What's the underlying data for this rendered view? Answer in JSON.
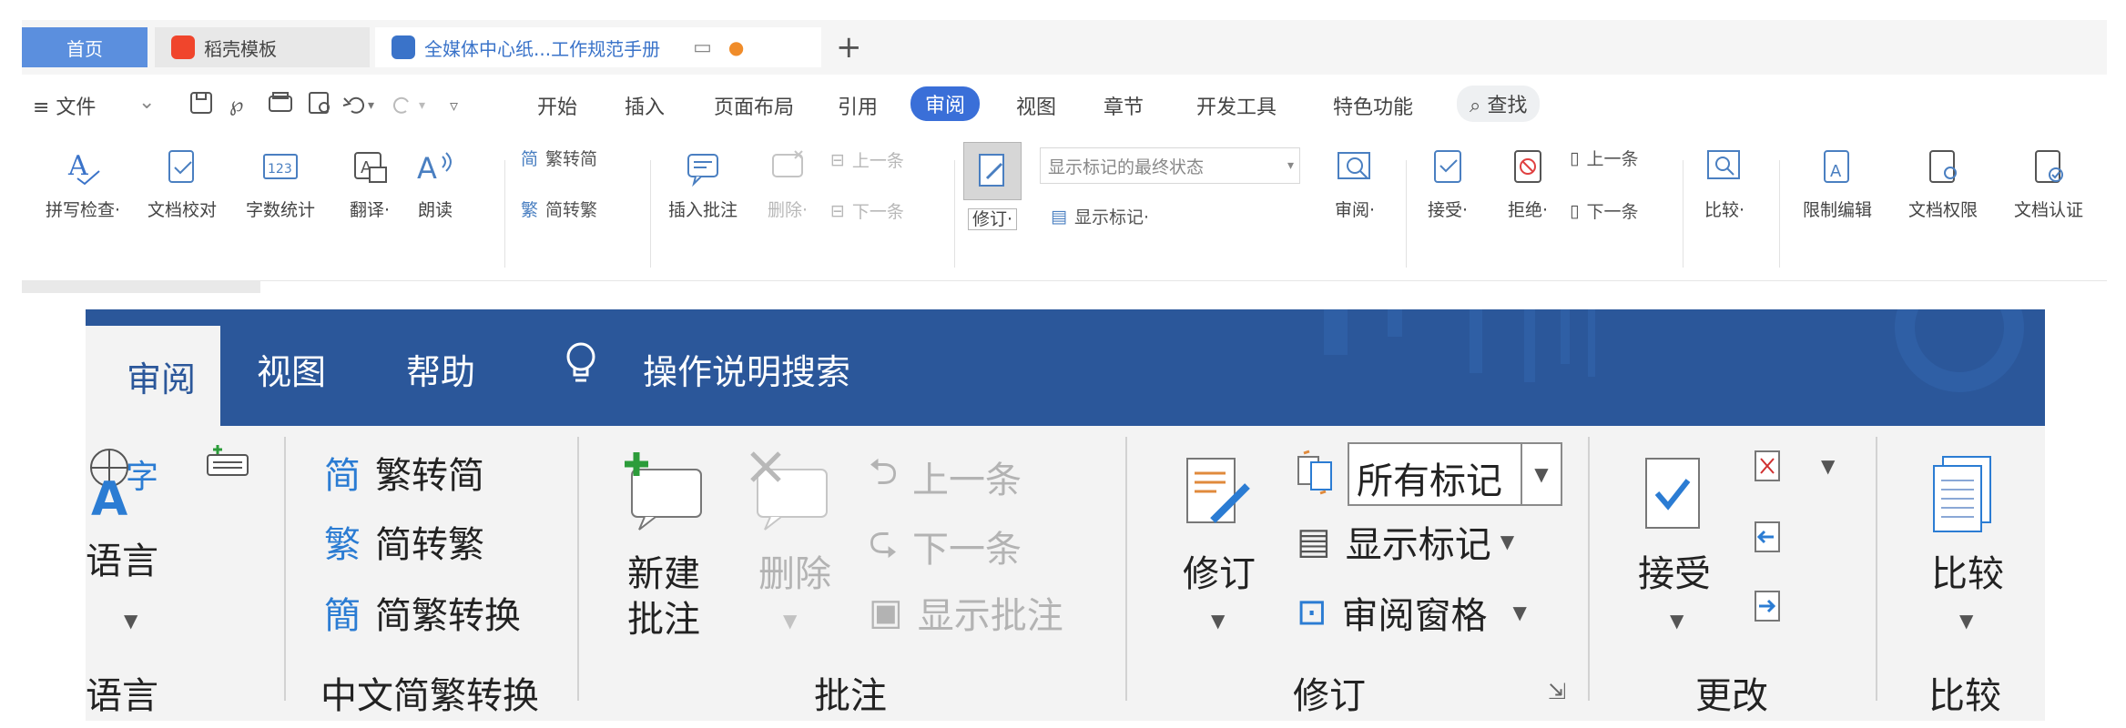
{
  "wps": {
    "tabs": [
      {
        "label": "首页"
      },
      {
        "label": "稻壳模板"
      },
      {
        "label": "全媒体中心纸...工作规范手册"
      }
    ],
    "new_tab_label": "+",
    "menu": {
      "file": "≡ 文件",
      "items": [
        "开始",
        "插入",
        "页面布局",
        "引用",
        "审阅",
        "视图",
        "章节",
        "开发工具",
        "特色功能"
      ],
      "search": "查找"
    },
    "ribbon": {
      "spell": "拼写检查·",
      "proof": "文档校对",
      "wordcount": "字数统计",
      "translate": "翻译·",
      "read": "朗读",
      "trad2simp": "繁转简",
      "simp2trad": "简转繁",
      "insert_comment": "插入批注",
      "delete": "删除·",
      "prev": "上一条",
      "next": "下一条",
      "track": "修订·",
      "markup_state": "显示标记的最终状态",
      "show_markup": "显示标记·",
      "review": "审阅·",
      "accept": "接受·",
      "reject": "拒绝·",
      "prev2": "上一条",
      "next2": "下一条",
      "compare": "比较·",
      "restrict": "限制编辑",
      "permission": "文档权限",
      "certify": "文档认证"
    }
  },
  "word": {
    "tabs": [
      "审阅",
      "视图",
      "帮助"
    ],
    "tell_me": "操作说明搜索",
    "language": {
      "label": "语言",
      "group": "语言"
    },
    "chinese": {
      "trad2simp": "繁转简",
      "simp2trad": "简转繁",
      "convert": "简繁转换",
      "group": "中文简繁转换",
      "icon_simp": "简",
      "icon_trad": "繁",
      "icon_convert": "簡"
    },
    "comments": {
      "new_line1": "新建",
      "new_line2": "批注",
      "delete": "删除",
      "prev": "上一条",
      "next": "下一条",
      "show": "显示批注",
      "group": "批注"
    },
    "tracking": {
      "track": "修订",
      "dropdown": "所有标记",
      "show_markup": "显示标记",
      "pane": "审阅窗格",
      "group": "修订"
    },
    "changes": {
      "accept": "接受",
      "group": "更改"
    },
    "compare": {
      "label": "比较",
      "group": "比较"
    }
  },
  "colors": {
    "wps_accent": "#3a6fd8",
    "word_blue": "#2b579a",
    "ribbon_bg": "#f3f3f3"
  }
}
